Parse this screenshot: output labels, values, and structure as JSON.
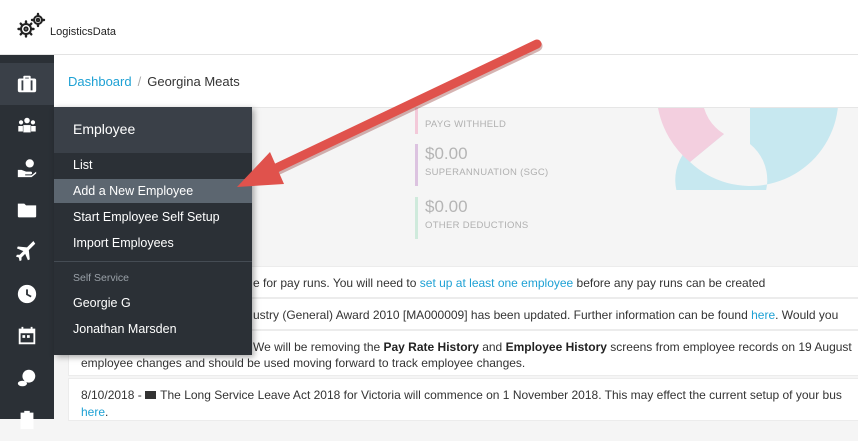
{
  "brand": {
    "name": "LogisticsData",
    "icon": "gears-icon"
  },
  "sidebar": {
    "items": [
      {
        "name": "briefcase",
        "icon": "briefcase-icon"
      },
      {
        "name": "employees",
        "icon": "users-icon"
      },
      {
        "name": "payments",
        "icon": "hand-money-icon"
      },
      {
        "name": "files",
        "icon": "folder-icon"
      },
      {
        "name": "travel",
        "icon": "plane-icon"
      },
      {
        "name": "time",
        "icon": "clock-icon"
      },
      {
        "name": "calendar",
        "icon": "calendar-icon"
      },
      {
        "name": "money",
        "icon": "coins-icon"
      },
      {
        "name": "reports",
        "icon": "clipboard-icon"
      }
    ]
  },
  "breadcrumb": {
    "dashboard": "Dashboard",
    "separator": "/",
    "current": "Georgina Meats"
  },
  "stats": [
    {
      "amount": "",
      "label": "PAYG WITHHELD",
      "color": "#f3c9d9"
    },
    {
      "amount": "$0.00",
      "label": "SUPERANNUATION (SGC)",
      "color": "#dcc3e0"
    },
    {
      "amount": "$0.00",
      "label": "OTHER DEDUCTIONS",
      "color": "#cfeadc"
    }
  ],
  "donut": {
    "colors": [
      "#c7e8f0",
      "#f3cfdf"
    ]
  },
  "notices": {
    "n1": {
      "text_pre": "e for pay runs. You will need to ",
      "link": "set up at least one employee",
      "text_post": " before any pay runs can be created"
    },
    "n2": {
      "text_pre": "ustry (General) Award 2010 [MA000009] has been updated. Further information can be found ",
      "link": "here",
      "text_post": ". Would you"
    },
    "n3": {
      "text_pre": "We will be removing the ",
      "b1": "Pay Rate History",
      "mid": " and ",
      "b2": "Employee History",
      "text_post": " screens from employee records on 19 August",
      "line2": "employee changes and should be used moving forward to track employee changes."
    },
    "n4": {
      "date": "8/10/2018 - ",
      "text": " The Long Service Leave Act 2018 for Victoria will commence on 1 November 2018. This may effect the current setup of your bus",
      "link": "here",
      "tail": "."
    }
  },
  "flyout": {
    "title": "Employee",
    "items": [
      "List",
      "Add a New Employee",
      "Start Employee Self Setup",
      "Import Employees"
    ],
    "section_label": "Self Service",
    "self_service": [
      "Georgie G",
      "Jonathan Marsden"
    ]
  },
  "annotation": {
    "arrow_color": "#e0524c"
  }
}
